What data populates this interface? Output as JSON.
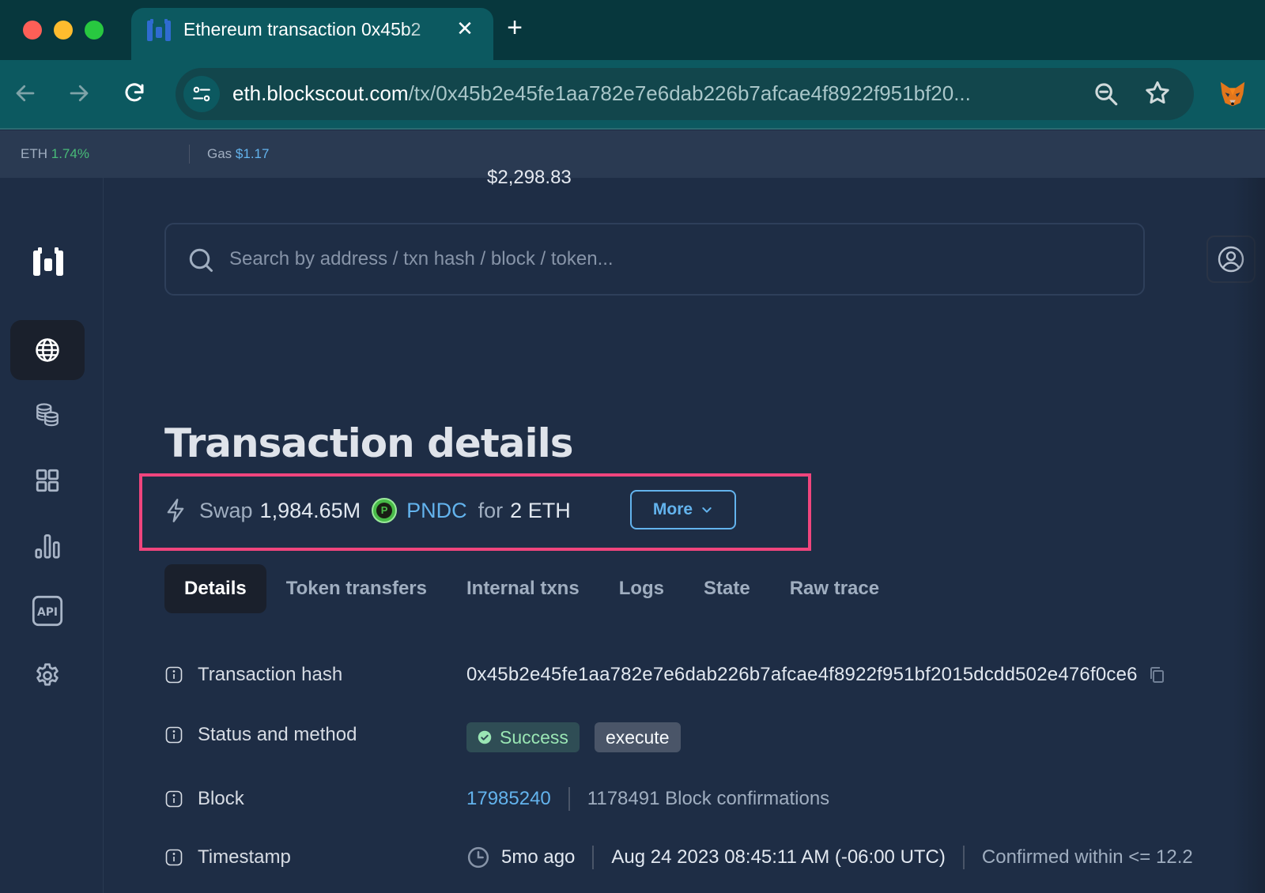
{
  "browser": {
    "tab_title": "Ethereum transaction 0x45b2",
    "tab_close_glyph": "✕",
    "new_tab_glyph": "+",
    "url_host": "eth.blockscout.com",
    "url_path": "/tx/0x45b2e45fe1aa782e7e6dab226b7afcae4f8922f951bf20..."
  },
  "stats": {
    "eth_label": "ETH",
    "eth_price": "$2,298.83",
    "eth_change": "1.74%",
    "gas_label": "Gas",
    "gas_price": "$1.17",
    "colors": {
      "change": "#48bb78",
      "gas": "#63b3ed"
    }
  },
  "sidebar": {
    "items": [
      {
        "name": "blockchain",
        "icon": "globe-icon",
        "active": true
      },
      {
        "name": "tokens",
        "icon": "coins-icon",
        "active": false
      },
      {
        "name": "apps",
        "icon": "grid-icon",
        "active": false
      },
      {
        "name": "charts-stats",
        "icon": "bar-chart-icon",
        "active": false
      },
      {
        "name": "api",
        "icon": "api-icon",
        "active": false
      },
      {
        "name": "settings",
        "icon": "gear-icon",
        "active": false
      }
    ]
  },
  "search": {
    "placeholder": "Search by address / txn hash / block / token...",
    "value": ""
  },
  "page": {
    "title": "Transaction details"
  },
  "summary": {
    "action": "Swap",
    "amount": "1,984.65M",
    "token_symbol": "PNDC",
    "token_icon_letter": "P",
    "connector": "for",
    "to_amount": "2 ETH",
    "more_label": "More",
    "highlight_color": "#f0457d"
  },
  "tabs": [
    {
      "label": "Details",
      "active": true
    },
    {
      "label": "Token transfers",
      "active": false
    },
    {
      "label": "Internal txns",
      "active": false
    },
    {
      "label": "Logs",
      "active": false
    },
    {
      "label": "State",
      "active": false
    },
    {
      "label": "Raw trace",
      "active": false
    }
  ],
  "details": {
    "hash": {
      "label": "Transaction hash",
      "value": "0x45b2e45fe1aa782e7e6dab226b7afcae4f8922f951bf2015dcdd502e476f0ce6"
    },
    "status": {
      "label": "Status and method",
      "status": "Success",
      "method": "execute"
    },
    "block": {
      "label": "Block",
      "number": "17985240",
      "confirmations": "1178491 Block confirmations"
    },
    "timestamp": {
      "label": "Timestamp",
      "relative": "5mo ago",
      "absolute": "Aug 24 2023 08:45:11 AM (-06:00 UTC)",
      "confirmed": "Confirmed within <= 12.2"
    }
  }
}
